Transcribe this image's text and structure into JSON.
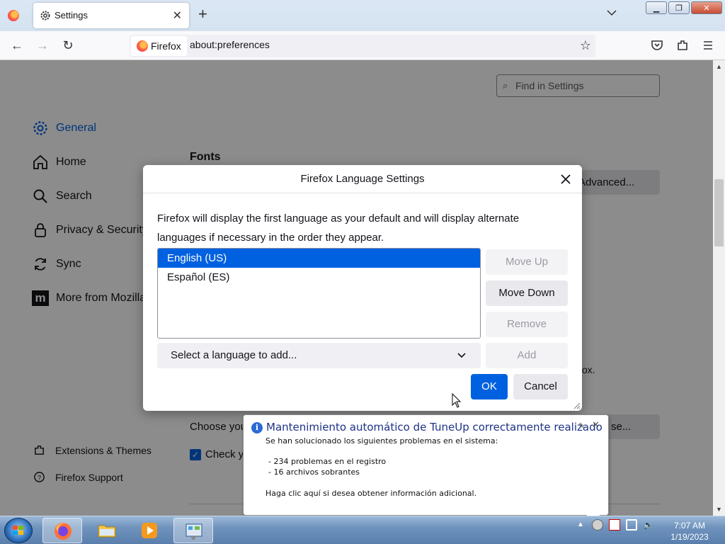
{
  "tab": {
    "title": "Settings"
  },
  "address": {
    "identity": "Firefox",
    "url": "about:preferences"
  },
  "settings": {
    "search_placeholder": "Find in Settings",
    "nav": [
      {
        "label": "General"
      },
      {
        "label": "Home"
      },
      {
        "label": "Search"
      },
      {
        "label": "Privacy & Security"
      },
      {
        "label": "Sync"
      },
      {
        "label": "More from Mozilla"
      }
    ],
    "footer": [
      {
        "label": "Extensions & Themes"
      },
      {
        "label": "Firefox Support"
      }
    ],
    "fonts_heading": "Fonts",
    "advanced_button": "Advanced...",
    "truncated_fox": "fox.",
    "choose_text": "Choose you",
    "truncated_se_button": "se...",
    "check_text": "Check yo"
  },
  "dialog": {
    "title": "Firefox Language Settings",
    "description": "Firefox will display the first language as your default and will display alternate languages if necessary in the order they appear.",
    "languages": [
      {
        "label": "English (US)",
        "selected": true
      },
      {
        "label": "Español (ES)",
        "selected": false
      }
    ],
    "move_up": "Move Up",
    "move_down": "Move Down",
    "remove": "Remove",
    "add_select": "Select a language to add...",
    "add": "Add",
    "ok": "OK",
    "cancel": "Cancel"
  },
  "notification": {
    "title": "Mantenimiento automático de TuneUp correctamente realizado",
    "line1": "Se han solucionado los siguientes problemas en el sistema:",
    "item1": "- 234 problemas en el registro",
    "item2": "- 16 archivos sobrantes",
    "footer": "Haga clic aquí si desea obtener información adicional."
  },
  "taskbar": {
    "time": "7:07 AM",
    "date": "1/19/2023"
  },
  "colors": {
    "accent": "#0061e0",
    "notification_title": "#1e3287"
  }
}
